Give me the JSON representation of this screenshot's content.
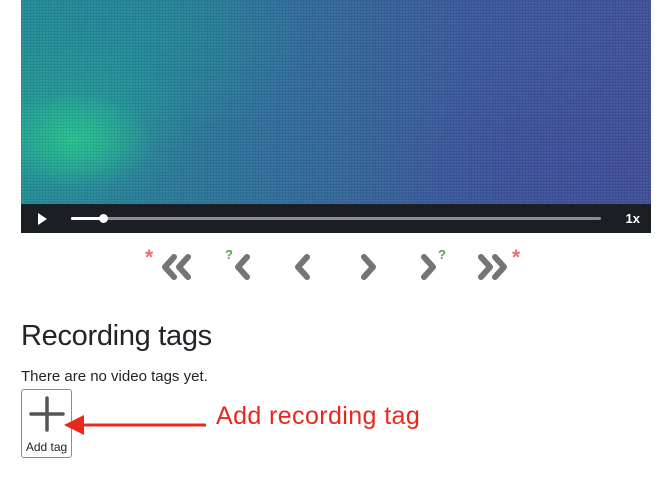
{
  "player": {
    "progress": 0.06,
    "speed_label": "1x",
    "play_icon": "play-icon"
  },
  "navigation": {
    "buttons": [
      {
        "name": "first-tag-button",
        "icon": "double-chevron-left-icon",
        "mark": "*"
      },
      {
        "name": "previous-uncertain-button",
        "icon": "chevron-left-icon",
        "mark": "?"
      },
      {
        "name": "previous-button",
        "icon": "chevron-left-icon",
        "mark": ""
      },
      {
        "name": "next-button",
        "icon": "chevron-right-icon",
        "mark": ""
      },
      {
        "name": "next-uncertain-button",
        "icon": "chevron-right-icon",
        "mark": "?"
      },
      {
        "name": "last-tag-button",
        "icon": "double-chevron-right-icon",
        "mark": "*"
      }
    ],
    "mark_colors": {
      "star": "#f26d6d",
      "question": "#55a64a"
    }
  },
  "tags_section": {
    "title": "Recording tags",
    "empty_message": "There are no video tags yet.",
    "add_button_label": "Add tag"
  },
  "annotation": {
    "text": "Add recording tag",
    "color": "#e8281e"
  }
}
